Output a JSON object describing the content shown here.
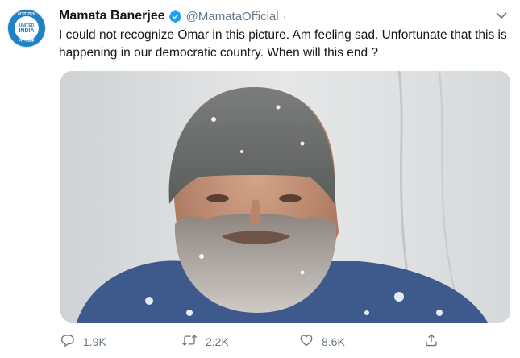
{
  "tweet": {
    "display_name": "Mamata Banerjee",
    "handle": "@MamataOfficial",
    "separator": "·",
    "text": "I could not recognize Omar in this picture. Am feeling sad. Unfortunate that this is happening in our democratic country. When will this end ?",
    "avatar": {
      "top_text": "#CITIZEN",
      "line1": "UNITED",
      "line2": "INDIA",
      "bottom_text": "নাগরিক"
    },
    "media_icon": "photo-of-bearded-man-in-beanie"
  },
  "actions": {
    "reply": {
      "icon": "reply-icon",
      "count": "1.9K"
    },
    "retweet": {
      "icon": "retweet-icon",
      "count": "2.2K"
    },
    "like": {
      "icon": "heart-icon",
      "count": "8.6K"
    },
    "share": {
      "icon": "share-icon"
    }
  },
  "colors": {
    "verified": "#1da1f2",
    "secondary_text": "#657786",
    "avatar_brand": "#1e82c4"
  }
}
